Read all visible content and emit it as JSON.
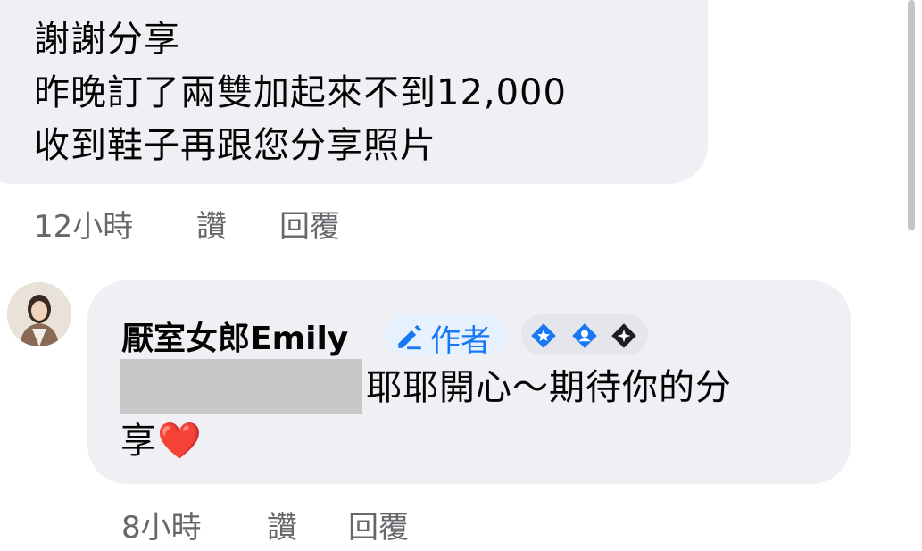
{
  "comment1": {
    "lines": [
      "謝謝分享",
      "昨晚訂了兩雙加起來不到12,000",
      "收到鞋子再跟您分享照片"
    ],
    "time": "12小時",
    "like": "讚",
    "reply": "回覆"
  },
  "comment2": {
    "author": "厭室女郎Emily",
    "author_badge": "作者",
    "text_line1": "耶耶開心～期待你的分",
    "text_line2": "享❤️",
    "time": "8小時",
    "like": "讚",
    "reply": "回覆",
    "badge_icons": [
      "star-badge-icon",
      "person-badge-icon",
      "sparkle-badge-icon"
    ]
  },
  "colors": {
    "bubble": "#f0f0f4",
    "meta_text": "#65676b",
    "accent": "#1877f2",
    "redaction": "#c8c8c8"
  }
}
